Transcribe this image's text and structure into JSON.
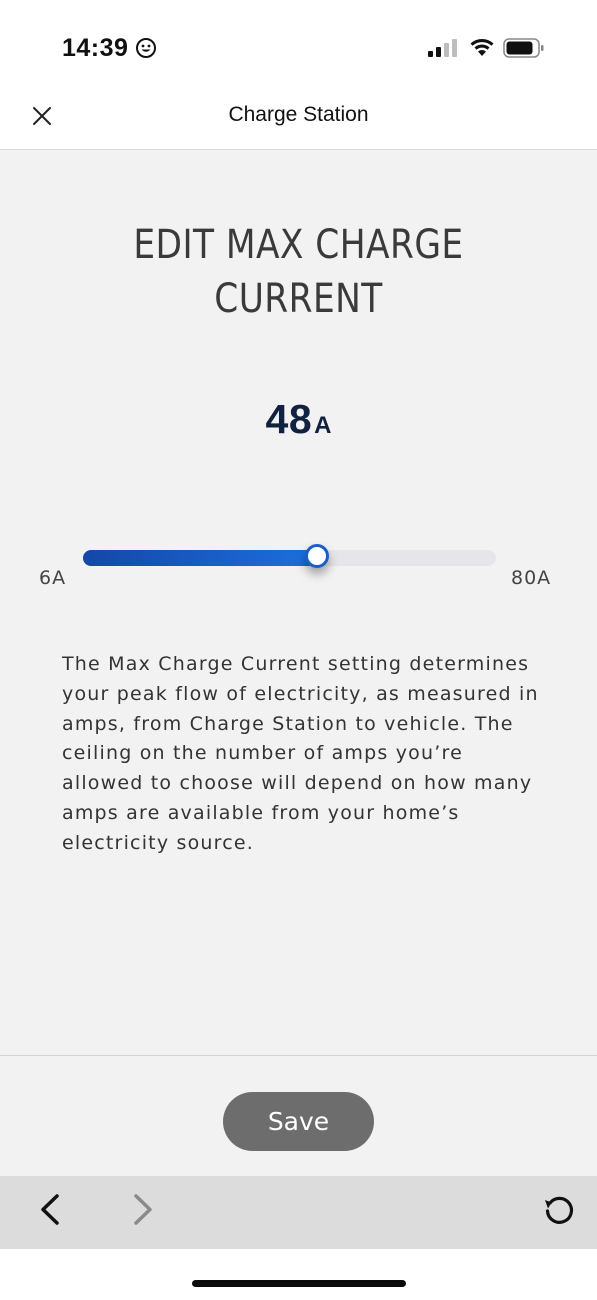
{
  "status_bar": {
    "time": "14:39",
    "icons": [
      "smiley-icon",
      "cellular-signal-icon",
      "wifi-icon",
      "battery-icon"
    ]
  },
  "nav": {
    "title": "Charge Station",
    "close_icon": "close-icon"
  },
  "page": {
    "heading_line1": "EDIT MAX CHARGE",
    "heading_line2": "CURRENT",
    "current_value": "48",
    "current_unit": "A",
    "slider": {
      "min_label": "6A",
      "max_label": "80A",
      "min": 6,
      "max": 80,
      "value": 48,
      "fill_color": "#1a5fc9"
    },
    "description": "The Max Charge Current setting determines your peak flow of electricity, as measured in amps, from Charge Station to vehicle. The ceiling on the number of amps you’re allowed to choose will depend on how many amps are available from your home’s electricity source."
  },
  "footer": {
    "save_label": "Save",
    "save_color": "#6d6d6d"
  },
  "browser_toolbar": {
    "icons": [
      "back-arrow-icon",
      "forward-arrow-icon",
      "reload-icon"
    ]
  }
}
